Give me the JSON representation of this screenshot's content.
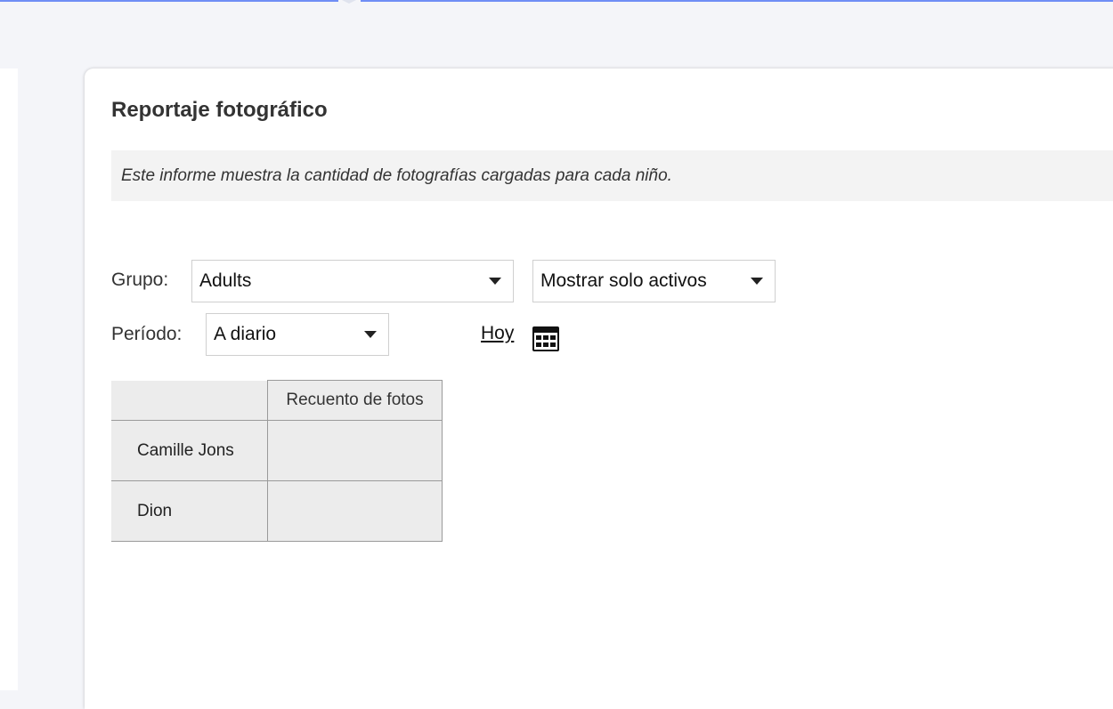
{
  "report": {
    "title": "Reportaje fotográfico",
    "description": "Este informe muestra la cantidad de fotografías cargadas para cada niño."
  },
  "filters": {
    "group_label": "Grupo:",
    "group_value": "Adults",
    "status_value": "Mostrar solo activos",
    "period_label": "Período:",
    "period_value": "A diario",
    "today_link": "Hoy"
  },
  "table": {
    "headers": [
      "",
      "Recuento de fotos"
    ],
    "rows": [
      {
        "name": "Camille Jons",
        "count": ""
      },
      {
        "name": "Dion",
        "count": ""
      }
    ]
  },
  "colors": {
    "accent": "#6f8ef5",
    "background": "#f4f5f9",
    "table_fill": "#ececec"
  },
  "icons": {
    "calendar": "calendar-icon",
    "dropdown": "chevron-down-icon"
  }
}
